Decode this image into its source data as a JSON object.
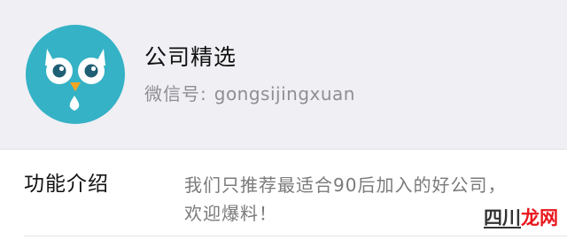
{
  "profile": {
    "account_name": "公司精选",
    "wechat_id_label": "微信号:",
    "wechat_id_value": "gongsijingxuan",
    "avatar_icon": "owl-avatar-icon"
  },
  "function_intro": {
    "label": "功能介绍",
    "description": "我们只推荐最适合90后加入的好公司，欢迎爆料！"
  },
  "watermark": {
    "part1": "四川",
    "part2": "龙网"
  },
  "colors": {
    "header_bg": "#efeff4",
    "avatar_teal": "#35b2c5",
    "beak_orange": "#f5a623",
    "text_primary": "#111111",
    "text_secondary": "#8e8e93",
    "watermark_red": "#e8161c"
  }
}
